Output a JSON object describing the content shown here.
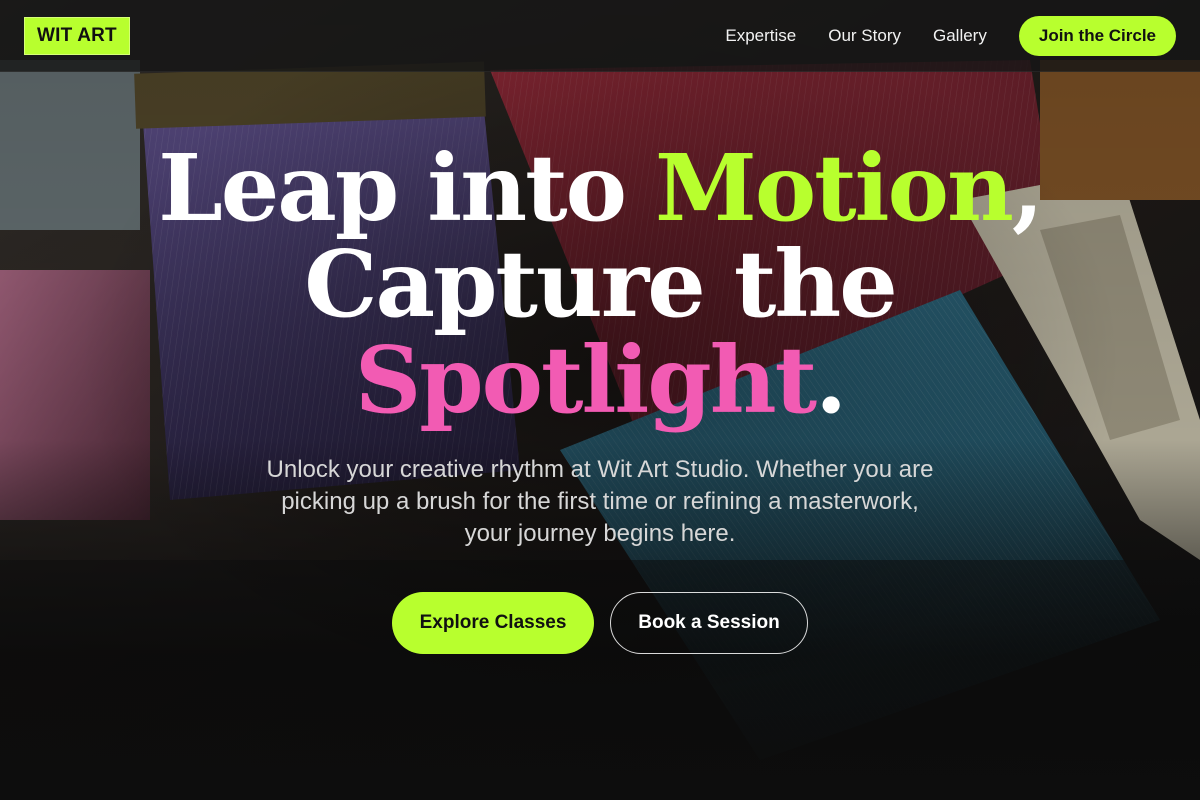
{
  "nav": {
    "logo": "WIT ART",
    "links": [
      "Expertise",
      "Our Story",
      "Gallery"
    ],
    "cta": "Join the Circle"
  },
  "hero": {
    "headline": {
      "line1_a": "Leap into ",
      "line1_accent": "Motion",
      "line1_b": ",",
      "line2": "Capture the",
      "line3_accent": "Spotlight",
      "line3_b": "."
    },
    "subtitle": "Unlock your creative rhythm at Wit Art Studio. Whether you are picking up a brush for the first time or refining a masterwork, your journey begins here.",
    "primary_cta": "Explore Classes",
    "secondary_cta": "Book a Session"
  },
  "colors": {
    "accent_green": "#b8ff2e",
    "accent_pink": "#f25bb3",
    "background": "#0d0d0d"
  },
  "icons": {
    "background_image": "paint-brushes-photo"
  }
}
